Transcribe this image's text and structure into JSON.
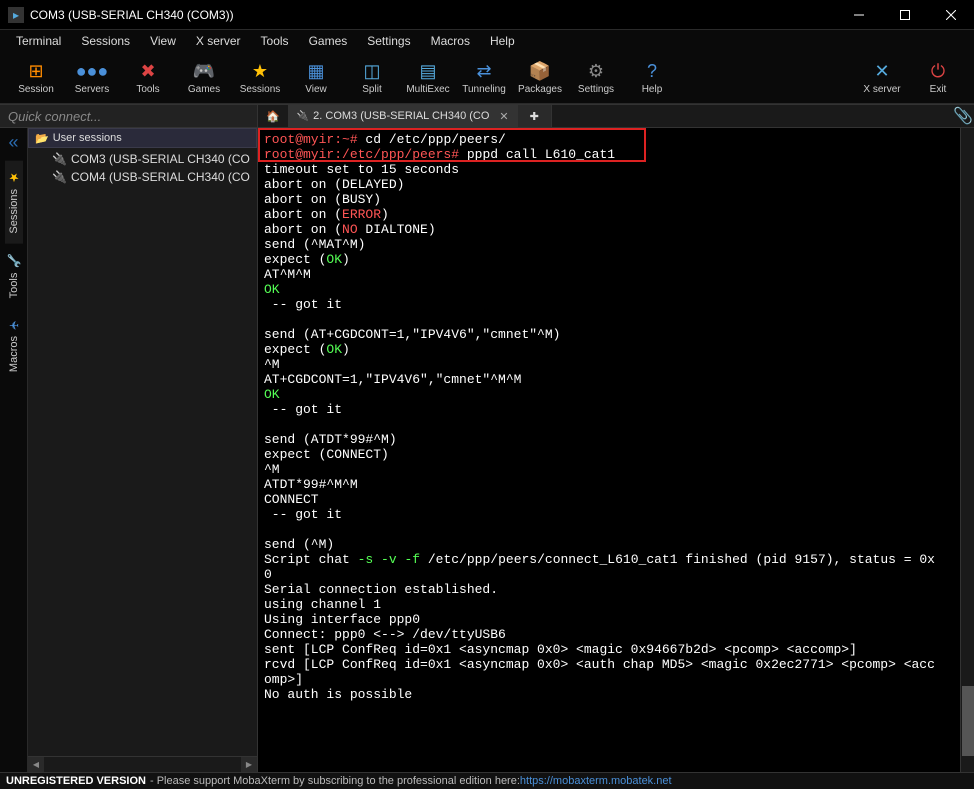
{
  "titlebar": {
    "title": "COM3  (USB-SERIAL CH340 (COM3))"
  },
  "menubar": [
    "Terminal",
    "Sessions",
    "View",
    "X server",
    "Tools",
    "Games",
    "Settings",
    "Macros",
    "Help"
  ],
  "toolbar_left": [
    {
      "label": "Session",
      "icon": "⊞",
      "color": "#ff8c00"
    },
    {
      "label": "Servers",
      "icon": "●●●",
      "color": "#4a90d9"
    },
    {
      "label": "Tools",
      "icon": "✖",
      "color": "#d44"
    },
    {
      "label": "Games",
      "icon": "🎮",
      "color": "#ddd"
    },
    {
      "label": "Sessions",
      "icon": "★",
      "color": "#ffc107"
    },
    {
      "label": "View",
      "icon": "▦",
      "color": "#4a90d9"
    },
    {
      "label": "Split",
      "icon": "◫",
      "color": "#5ad"
    },
    {
      "label": "MultiExec",
      "icon": "▤",
      "color": "#5ad"
    },
    {
      "label": "Tunneling",
      "icon": "⇄",
      "color": "#4a90d9"
    },
    {
      "label": "Packages",
      "icon": "📦",
      "color": "#c78"
    },
    {
      "label": "Settings",
      "icon": "⚙",
      "color": "#888"
    },
    {
      "label": "Help",
      "icon": "?",
      "color": "#4a90d9"
    }
  ],
  "toolbar_right": [
    {
      "label": "X server",
      "icon": "✕",
      "color": "#5ad"
    },
    {
      "label": "Exit",
      "icon": "⏻",
      "color": "#d44"
    }
  ],
  "quick_connect": {
    "placeholder": "Quick connect..."
  },
  "tabs": [
    {
      "label": "",
      "home": true
    },
    {
      "label": "2. COM3  (USB-SERIAL CH340 (CO",
      "active": true,
      "closable": true
    }
  ],
  "leftrail": [
    {
      "label": "Sessions",
      "icon": "star"
    },
    {
      "label": "Tools",
      "icon": "wrench"
    },
    {
      "label": "Macros",
      "icon": "plane"
    }
  ],
  "sidebar": {
    "header": "User sessions",
    "items": [
      "COM3  (USB-SERIAL CH340 (CO",
      "COM4  (USB-SERIAL CH340 (CO"
    ]
  },
  "terminal": {
    "lines": [
      [
        {
          "c": "prompt",
          "t": "root@myir:~#"
        },
        {
          "c": "white",
          "t": " cd /etc/ppp/peers/"
        }
      ],
      [
        {
          "c": "prompt",
          "t": "root@myir:/etc/ppp/peers#"
        },
        {
          "c": "white",
          "t": " pppd call L610_cat1"
        }
      ],
      [
        {
          "c": "white",
          "t": "timeout set to 15 seconds"
        }
      ],
      [
        {
          "c": "white",
          "t": "abort on (DELAYED)"
        }
      ],
      [
        {
          "c": "white",
          "t": "abort on (BUSY)"
        }
      ],
      [
        {
          "c": "white",
          "t": "abort on ("
        },
        {
          "c": "red",
          "t": "ERROR"
        },
        {
          "c": "white",
          "t": ")"
        }
      ],
      [
        {
          "c": "white",
          "t": "abort on ("
        },
        {
          "c": "red",
          "t": "NO"
        },
        {
          "c": "white",
          "t": " DIALTONE)"
        }
      ],
      [
        {
          "c": "white",
          "t": "send (^MAT^M)"
        }
      ],
      [
        {
          "c": "white",
          "t": "expect ("
        },
        {
          "c": "green",
          "t": "OK"
        },
        {
          "c": "white",
          "t": ")"
        }
      ],
      [
        {
          "c": "white",
          "t": "AT^M^M"
        }
      ],
      [
        {
          "c": "green",
          "t": "OK"
        }
      ],
      [
        {
          "c": "white",
          "t": " -- got it"
        }
      ],
      [
        {
          "c": "white",
          "t": ""
        }
      ],
      [
        {
          "c": "white",
          "t": "send (AT+CGDCONT=1,\"IPV4V6\",\"cmnet\"^M)"
        }
      ],
      [
        {
          "c": "white",
          "t": "expect ("
        },
        {
          "c": "green",
          "t": "OK"
        },
        {
          "c": "white",
          "t": ")"
        }
      ],
      [
        {
          "c": "white",
          "t": "^M"
        }
      ],
      [
        {
          "c": "white",
          "t": "AT+CGDCONT=1,\"IPV4V6\",\"cmnet\"^M^M"
        }
      ],
      [
        {
          "c": "green",
          "t": "OK"
        }
      ],
      [
        {
          "c": "white",
          "t": " -- got it"
        }
      ],
      [
        {
          "c": "white",
          "t": ""
        }
      ],
      [
        {
          "c": "white",
          "t": "send (ATDT*99#^M)"
        }
      ],
      [
        {
          "c": "white",
          "t": "expect (CONNECT)"
        }
      ],
      [
        {
          "c": "white",
          "t": "^M"
        }
      ],
      [
        {
          "c": "white",
          "t": "ATDT*99#^M^M"
        }
      ],
      [
        {
          "c": "white",
          "t": "CONNECT"
        }
      ],
      [
        {
          "c": "white",
          "t": " -- got it"
        }
      ],
      [
        {
          "c": "white",
          "t": ""
        }
      ],
      [
        {
          "c": "white",
          "t": "send (^M)"
        }
      ],
      [
        {
          "c": "white",
          "t": "Script chat "
        },
        {
          "c": "green",
          "t": "-s"
        },
        {
          "c": "white",
          "t": " "
        },
        {
          "c": "green",
          "t": "-v"
        },
        {
          "c": "white",
          "t": " "
        },
        {
          "c": "green",
          "t": "-f"
        },
        {
          "c": "white",
          "t": " /etc/ppp/peers/connect_L610_cat1 finished (pid 9157), status = 0x"
        }
      ],
      [
        {
          "c": "white",
          "t": "0"
        }
      ],
      [
        {
          "c": "white",
          "t": "Serial connection established."
        }
      ],
      [
        {
          "c": "white",
          "t": "using channel 1"
        }
      ],
      [
        {
          "c": "white",
          "t": "Using interface ppp0"
        }
      ],
      [
        {
          "c": "white",
          "t": "Connect: ppp0 <--> /dev/ttyUSB6"
        }
      ],
      [
        {
          "c": "white",
          "t": "sent [LCP ConfReq id=0x1 <asyncmap 0x0> <magic 0x94667b2d> <pcomp> <accomp>]"
        }
      ],
      [
        {
          "c": "white",
          "t": "rcvd [LCP ConfReq id=0x1 <asyncmap 0x0> <auth chap MD5> <magic 0x2ec2771> <pcomp> <acc"
        }
      ],
      [
        {
          "c": "white",
          "t": "omp>]"
        }
      ],
      [
        {
          "c": "white",
          "t": "No auth is possible"
        }
      ]
    ]
  },
  "statusbar": {
    "unreg": "UNREGISTERED VERSION",
    "msg": " -  Please support MobaXterm by subscribing to the professional edition here:  ",
    "link": "https://mobaxterm.mobatek.net"
  }
}
